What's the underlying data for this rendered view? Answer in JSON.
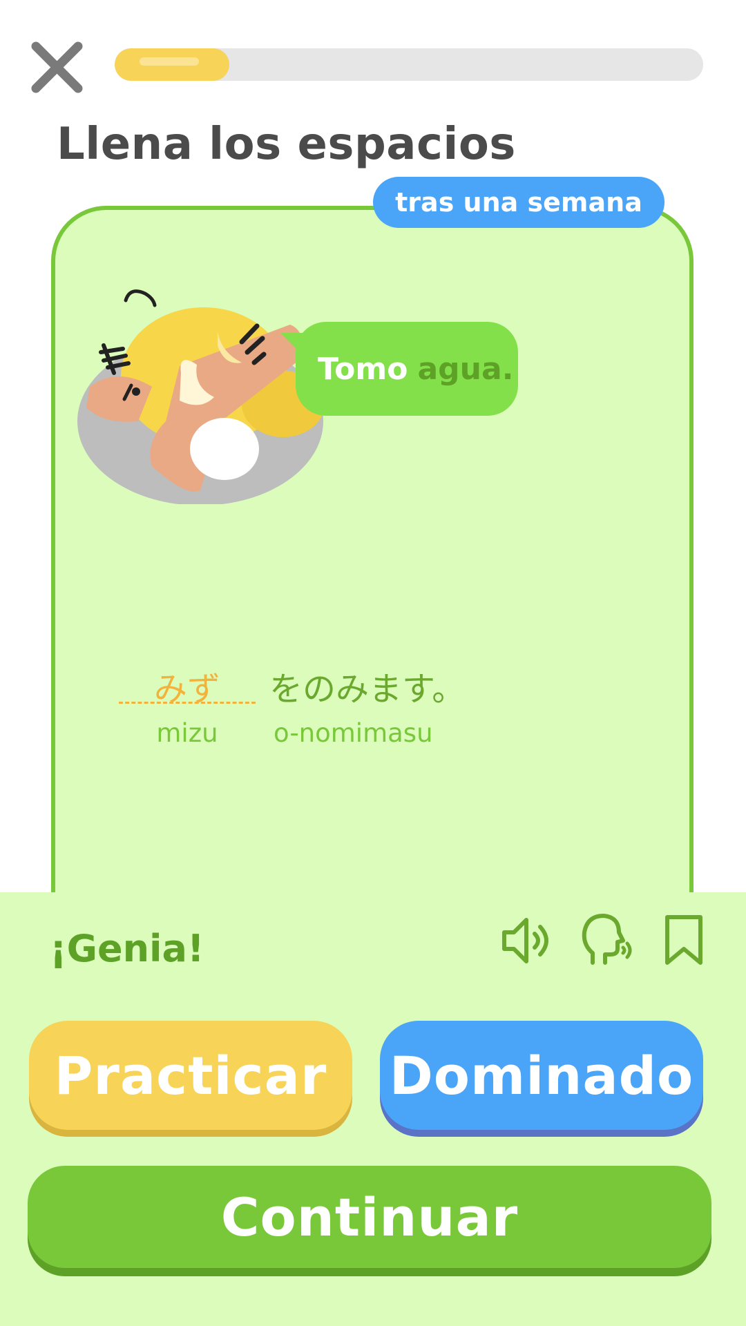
{
  "header": {
    "progress_fraction": 0.195,
    "close_icon": "close-x-icon"
  },
  "exercise": {
    "title": "Llena los espacios",
    "interval_badge": "tras una semana",
    "bubble": {
      "word_1": "Tomo",
      "word_2": "agua."
    },
    "sentence": {
      "answer_kana": "みず",
      "answer_romaji": "mizu",
      "rest_kana": "をのみます。",
      "rest_romaji": "o-nomimasu"
    }
  },
  "feedback": {
    "message": "¡Genia!",
    "icons": [
      "speaker-icon",
      "speak-head-icon",
      "bookmark-icon"
    ]
  },
  "actions": {
    "practice_label": "Practicar",
    "mastered_label": "Dominado",
    "continue_label": "Continuar"
  },
  "colors": {
    "green": "#78c83a",
    "light_green": "#dcfcbc",
    "yellow": "#f7d358",
    "blue": "#4aa4f7",
    "orange": "#f2b33d"
  }
}
